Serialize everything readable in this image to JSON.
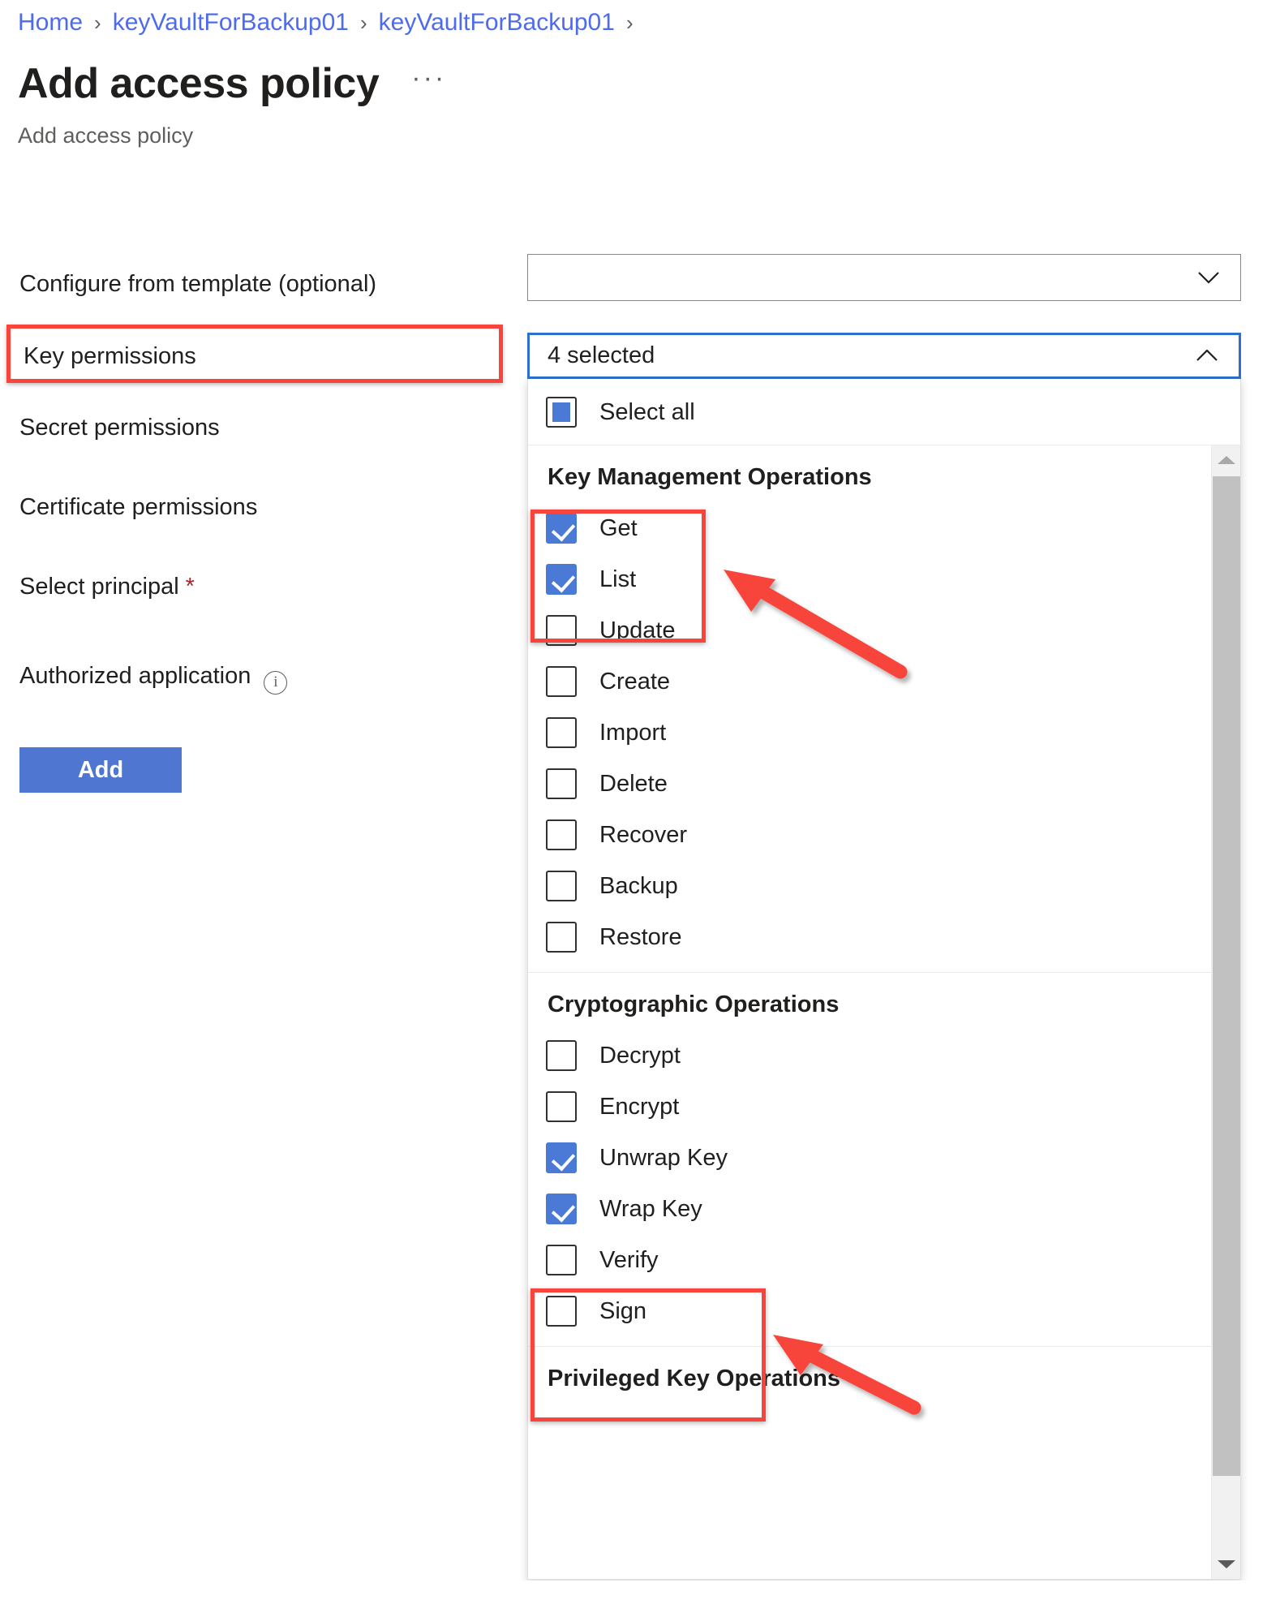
{
  "breadcrumb": {
    "items": [
      {
        "label": "Home"
      },
      {
        "label": "keyVaultForBackup01"
      },
      {
        "label": "keyVaultForBackup01"
      }
    ],
    "separator": "›"
  },
  "header": {
    "title": "Add access policy",
    "subtitle": "Add access policy",
    "more_label": "···"
  },
  "form": {
    "fields": [
      {
        "label": "Configure from template (optional)",
        "required": false
      },
      {
        "label": "Key permissions",
        "required": false,
        "highlighted": true
      },
      {
        "label": "Secret permissions",
        "required": false
      },
      {
        "label": "Certificate permissions",
        "required": false
      },
      {
        "label": "Select principal",
        "required": true,
        "required_mark": "*"
      },
      {
        "label": "Authorized application",
        "required": false,
        "info_icon": "info-icon",
        "info_glyph": "i"
      }
    ],
    "submit_label": "Add"
  },
  "template_select": {
    "value": "",
    "placeholder": "",
    "chevron": "chevron-down-icon"
  },
  "key_permissions": {
    "summary": "4 selected",
    "chevron": "chevron-up-icon",
    "expanded": true,
    "select_all": {
      "label": "Select all",
      "state": "indeterminate"
    },
    "groups": [
      {
        "title": "Key Management Operations",
        "options": [
          {
            "label": "Get",
            "checked": true,
            "annotated": true
          },
          {
            "label": "List",
            "checked": true,
            "annotated": true
          },
          {
            "label": "Update",
            "checked": false
          },
          {
            "label": "Create",
            "checked": false
          },
          {
            "label": "Import",
            "checked": false
          },
          {
            "label": "Delete",
            "checked": false
          },
          {
            "label": "Recover",
            "checked": false
          },
          {
            "label": "Backup",
            "checked": false
          },
          {
            "label": "Restore",
            "checked": false
          }
        ]
      },
      {
        "title": "Cryptographic Operations",
        "options": [
          {
            "label": "Decrypt",
            "checked": false
          },
          {
            "label": "Encrypt",
            "checked": false
          },
          {
            "label": "Unwrap Key",
            "checked": true,
            "annotated": true
          },
          {
            "label": "Wrap Key",
            "checked": true,
            "annotated": true
          },
          {
            "label": "Verify",
            "checked": false
          },
          {
            "label": "Sign",
            "checked": false
          }
        ]
      },
      {
        "title": "Privileged Key Operations",
        "clipped": true,
        "options": []
      }
    ],
    "scrollbar": {
      "up_arrow": "scroll-up-arrow-icon",
      "down_arrow": "scroll-down-arrow-icon",
      "thumb_position": "top"
    }
  },
  "annotations": {
    "color": "#f8443b",
    "boxes": [
      {
        "name": "key-permissions-label-highlight"
      },
      {
        "name": "get-list-highlight"
      },
      {
        "name": "unwrap-wrap-key-highlight"
      }
    ],
    "arrows": [
      {
        "name": "arrow-to-get-list"
      },
      {
        "name": "arrow-to-wrap-keys"
      }
    ]
  },
  "colors": {
    "link": "#4f6bed",
    "accent": "#4a7ad6",
    "button": "#4f76d0",
    "annotation": "#f8443b",
    "required": "#a4262c",
    "combo_focus": "#2f6fd0"
  }
}
